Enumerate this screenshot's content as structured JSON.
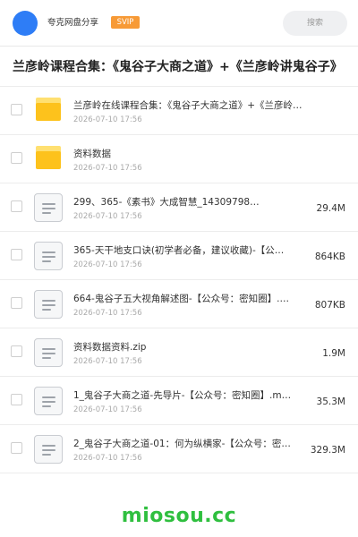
{
  "header": {
    "app_name": "夸克网盘分享",
    "badge": "SVIP",
    "search_placeholder": "搜索"
  },
  "page_title": "兰彦岭课程合集：《鬼谷子大商之道》+《兰彦岭讲鬼谷子》",
  "files": [
    {
      "icon": "folder-icon",
      "name": "兰彦岭在线课程合集：《鬼谷子大商之道》+《兰彦岭讲…",
      "date": "2026-07-10 17:56",
      "size": ""
    },
    {
      "icon": "folder-icon",
      "name": "资料数据",
      "date": "2026-07-10 17:56",
      "size": ""
    },
    {
      "icon": "document-icon",
      "name": "299、365-《素书》大成智慧_14309798…",
      "date": "2026-07-10 17:56",
      "size": "29.4M"
    },
    {
      "icon": "document-icon",
      "name": "365-天干地支口诀(初学者必备，建议收藏)-【公…",
      "date": "2026-07-10 17:56",
      "size": "864KB"
    },
    {
      "icon": "document-icon",
      "name": "664-鬼谷子五大视角解述图-【公众号：密知圈】.…",
      "date": "2026-07-10 17:56",
      "size": "807KB"
    },
    {
      "icon": "document-icon",
      "name": "资料数据资料.zip",
      "date": "2026-07-10 17:56",
      "size": "1.9M"
    },
    {
      "icon": "document-icon",
      "name": "1_鬼谷子大商之道-先导片-【公众号：密知圈】.m…",
      "date": "2026-07-10 17:56",
      "size": "35.3M"
    },
    {
      "icon": "document-icon",
      "name": "2_鬼谷子大商之道-01：何为纵横家-【公众号：密…",
      "date": "2026-07-10 17:56",
      "size": "329.3M"
    }
  ],
  "footer": {
    "watermark": "miosou.cc",
    "watermark_color": "#2fbf3f"
  },
  "colors": {
    "accent": "#2e7df6",
    "svip": "#f79a36",
    "folder": "#fdc21c"
  }
}
